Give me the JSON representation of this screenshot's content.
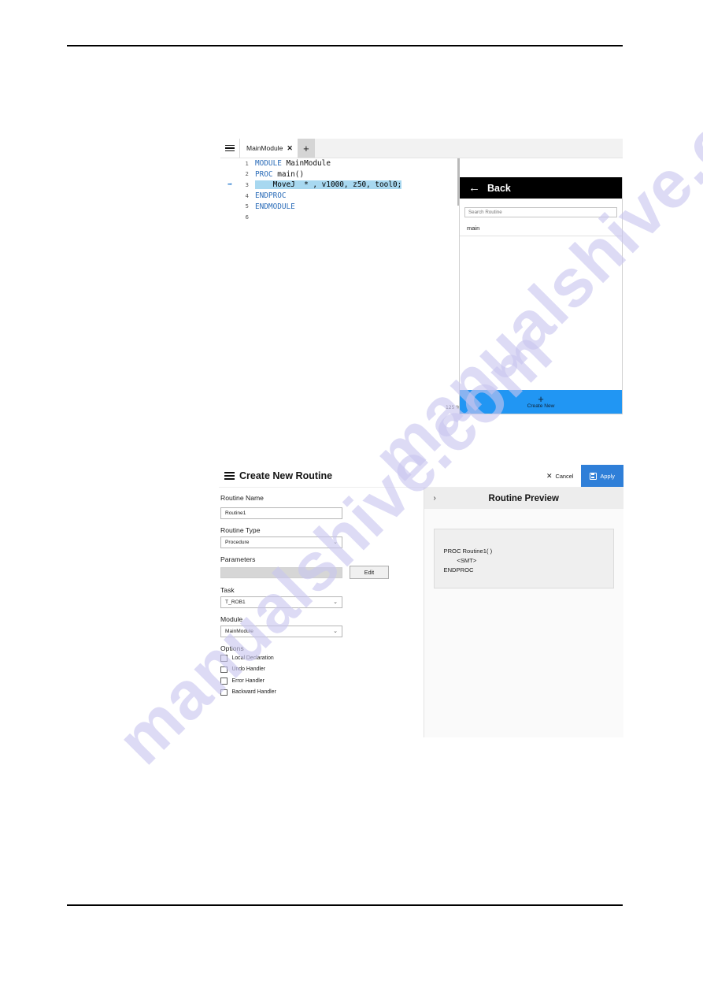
{
  "watermark": {
    "text_a": "manualshive.com",
    "text_b": "manualshive.com"
  },
  "editor": {
    "menu_icon": "hamburger-icon",
    "tab": {
      "label": "MainModule",
      "close_glyph": "✕"
    },
    "add_tab_glyph": "+",
    "zoom_level": "125 %",
    "lines": [
      {
        "num": "1",
        "marker": "",
        "segments": [
          {
            "text": "MODULE ",
            "style": "kw"
          },
          {
            "text": "MainModule",
            "style": "id"
          }
        ]
      },
      {
        "num": "2",
        "marker": "",
        "segments": [
          {
            "text": "PROC ",
            "style": "kw"
          },
          {
            "text": "main()",
            "style": "id"
          }
        ]
      },
      {
        "num": "3",
        "marker": "➡",
        "segments": [
          {
            "text": "    MoveJ  * , v1000, z50, tool0;",
            "style": "hl"
          }
        ]
      },
      {
        "num": "4",
        "marker": "",
        "segments": [
          {
            "text": "ENDPROC",
            "style": "kw"
          }
        ]
      },
      {
        "num": "5",
        "marker": "",
        "segments": [
          {
            "text": "ENDMODULE",
            "style": "kw"
          }
        ]
      },
      {
        "num": "6",
        "marker": "",
        "segments": [
          {
            "text": "",
            "style": "id"
          }
        ]
      }
    ],
    "routine_panel": {
      "back_label": "Back",
      "back_icon": "arrow-left-icon",
      "search_placeholder": "Search Routine",
      "search_value": "",
      "items": [
        {
          "label": "main"
        }
      ],
      "create_new": {
        "icon": "plus-icon",
        "label": "Create New",
        "color": "#2196f3"
      }
    }
  },
  "dialog": {
    "menu_icon": "hamburger-icon",
    "title": "Create New Routine",
    "cancel_label": "Cancel",
    "cancel_icon": "close-icon",
    "apply_label": "Apply",
    "apply_icon": "save-icon",
    "apply_color": "#2f7fd8",
    "fields": {
      "routine_name": {
        "label": "Routine Name",
        "value": "Routine1",
        "placeholder": "Routine1"
      },
      "routine_type": {
        "label": "Routine Type",
        "value": "Procedure"
      },
      "parameters": {
        "label": "Parameters",
        "value": "",
        "edit_label": "Edit"
      },
      "task": {
        "label": "Task",
        "value": "T_ROB1"
      },
      "module": {
        "label": "Module",
        "value": "MainModule"
      }
    },
    "options": {
      "label": "Options",
      "items": [
        {
          "label": "Local Declaration",
          "checked": false
        },
        {
          "label": "Undo Handler",
          "checked": false
        },
        {
          "label": "Error Handler",
          "checked": false
        },
        {
          "label": "Backward Handler",
          "checked": false
        }
      ]
    },
    "preview": {
      "title": "Routine Preview",
      "expand_icon": "chevron-right-icon",
      "code": "PROC Routine1( )\n        <SMT>\nENDPROC"
    }
  }
}
